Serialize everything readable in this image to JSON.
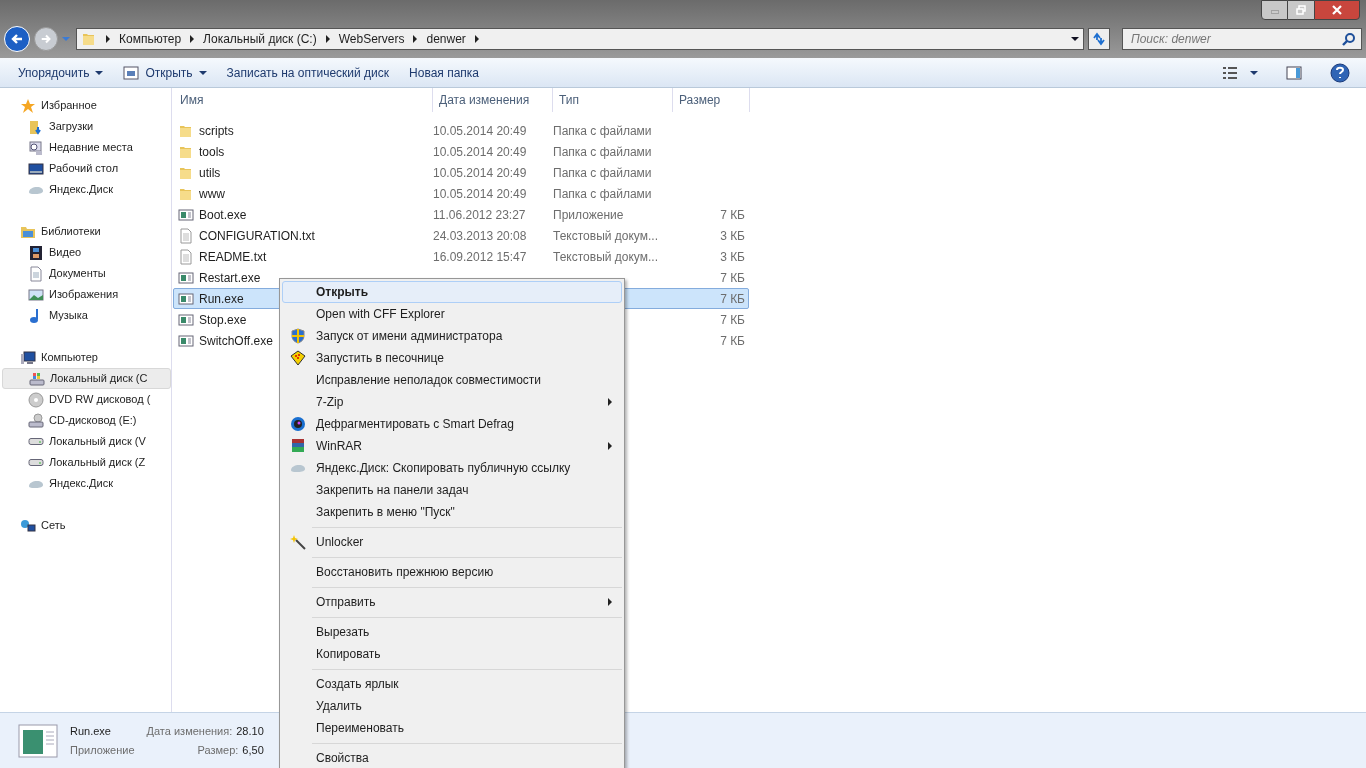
{
  "address": {
    "crumbs": [
      "Компьютер",
      "Локальный диск (C:)",
      "WebServers",
      "denwer"
    ]
  },
  "search": {
    "placeholder": "Поиск: denwer"
  },
  "toolbar": [
    {
      "label": "Упорядочить",
      "dropdown": true,
      "kind": "plain"
    },
    {
      "label": "Открыть",
      "dropdown": true,
      "kind": "open"
    },
    {
      "label": "Записать на оптический диск",
      "dropdown": false,
      "kind": "plain"
    },
    {
      "label": "Новая папка",
      "dropdown": false,
      "kind": "plain"
    }
  ],
  "sidebar": [
    {
      "label": "Избранное",
      "kind": "star",
      "children": [
        {
          "label": "Загрузки",
          "kind": "downloads",
          "selected": false
        },
        {
          "label": "Недавние места",
          "kind": "recent",
          "selected": false
        },
        {
          "label": "Рабочий стол",
          "kind": "desktop",
          "selected": false
        },
        {
          "label": "Яндекс.Диск",
          "kind": "cloud",
          "selected": false
        }
      ]
    },
    {
      "label": "Библиотеки",
      "kind": "library",
      "children": [
        {
          "label": "Видео",
          "kind": "video",
          "selected": false
        },
        {
          "label": "Документы",
          "kind": "docs",
          "selected": false
        },
        {
          "label": "Изображения",
          "kind": "images",
          "selected": false
        },
        {
          "label": "Музыка",
          "kind": "music",
          "selected": false
        }
      ]
    },
    {
      "label": "Компьютер",
      "kind": "computer",
      "children": [
        {
          "label": "Локальный диск (C",
          "kind": "sysdrive",
          "selected": true
        },
        {
          "label": "DVD RW дисковод (",
          "kind": "dvd",
          "selected": false
        },
        {
          "label": "CD-дисковод (E:)",
          "kind": "cd",
          "selected": false
        },
        {
          "label": "Локальный диск (V",
          "kind": "drive",
          "selected": false
        },
        {
          "label": "Локальный диск (Z",
          "kind": "drive",
          "selected": false
        },
        {
          "label": "Яндекс.Диск",
          "kind": "cloud",
          "selected": false
        }
      ]
    },
    {
      "label": "Сеть",
      "kind": "network"
    }
  ],
  "table": {
    "columns": [
      "Имя",
      "Дата изменения",
      "Тип",
      "Размер"
    ],
    "rows": [
      {
        "name": "scripts",
        "kind": "folder",
        "date": "10.05.2014 20:49",
        "type": "Папка с файлами",
        "selected": false
      },
      {
        "name": "tools",
        "kind": "folder",
        "date": "10.05.2014 20:49",
        "type": "Папка с файлами",
        "selected": false
      },
      {
        "name": "utils",
        "kind": "folder",
        "date": "10.05.2014 20:49",
        "type": "Папка с файлами",
        "selected": false
      },
      {
        "name": "www",
        "kind": "folder",
        "date": "10.05.2014 20:49",
        "type": "Папка с файлами",
        "selected": false
      },
      {
        "name": "Boot.exe",
        "kind": "exe",
        "date": "11.06.2012 23:27",
        "type": "Приложение",
        "size": "7 КБ",
        "selected": false
      },
      {
        "name": "CONFIGURATION.txt",
        "kind": "txt",
        "date": "24.03.2013 20:08",
        "type": "Текстовый докум...",
        "size": "3 КБ",
        "selected": false
      },
      {
        "name": "README.txt",
        "kind": "txt",
        "date": "16.09.2012 15:47",
        "type": "Текстовый докум...",
        "size": "3 КБ",
        "selected": false
      },
      {
        "name": "Restart.exe",
        "kind": "exe",
        "size": "7 КБ",
        "selected": false
      },
      {
        "name": "Run.exe",
        "kind": "exe",
        "size": "7 КБ",
        "selected": true
      },
      {
        "name": "Stop.exe",
        "kind": "exe",
        "size": "7 КБ",
        "selected": false
      },
      {
        "name": "SwitchOff.exe",
        "kind": "exe",
        "size": "7 КБ",
        "selected": false
      }
    ]
  },
  "context_menu": [
    [
      {
        "label": "Открыть",
        "kind": "plain",
        "bold": true,
        "submenu": false,
        "selected": true
      },
      {
        "label": "Open with CFF Explorer",
        "kind": "plain",
        "bold": false,
        "submenu": false,
        "selected": false
      },
      {
        "label": "Запуск от имени администратора",
        "kind": "shield",
        "bold": false,
        "submenu": false,
        "selected": false
      },
      {
        "label": "Запустить в песочнице",
        "kind": "sandbox",
        "bold": false,
        "submenu": false,
        "selected": false
      },
      {
        "label": "Исправление неполадок совместимости",
        "kind": "plain",
        "bold": false,
        "submenu": false,
        "selected": false
      },
      {
        "label": "7-Zip",
        "kind": "plain",
        "bold": false,
        "submenu": true,
        "selected": false
      },
      {
        "label": "Дефрагментировать с Smart Defrag",
        "kind": "defrag",
        "bold": false,
        "submenu": false,
        "selected": false
      },
      {
        "label": "WinRAR",
        "kind": "archive",
        "bold": false,
        "submenu": true,
        "selected": false
      },
      {
        "label": "Яндекс.Диск: Скопировать публичную ссылку",
        "kind": "cloud",
        "bold": false,
        "submenu": false,
        "selected": false
      },
      {
        "label": "Закрепить на панели задач",
        "kind": "plain",
        "bold": false,
        "submenu": false,
        "selected": false
      },
      {
        "label": "Закрепить в меню \"Пуск\"",
        "kind": "plain",
        "bold": false,
        "submenu": false,
        "selected": false
      }
    ],
    [
      {
        "label": "Unlocker",
        "kind": "wand",
        "bold": false,
        "submenu": false,
        "selected": false
      }
    ],
    [
      {
        "label": "Восстановить прежнюю версию",
        "kind": "plain",
        "bold": false,
        "submenu": false,
        "selected": false
      }
    ],
    [
      {
        "label": "Отправить",
        "kind": "plain",
        "bold": false,
        "submenu": true,
        "selected": false
      }
    ],
    [
      {
        "label": "Вырезать",
        "kind": "plain",
        "bold": false,
        "submenu": false,
        "selected": false
      },
      {
        "label": "Копировать",
        "kind": "plain",
        "bold": false,
        "submenu": false,
        "selected": false
      }
    ],
    [
      {
        "label": "Создать ярлык",
        "kind": "plain",
        "bold": false,
        "submenu": false,
        "selected": false
      },
      {
        "label": "Удалить",
        "kind": "plain",
        "bold": false,
        "submenu": false,
        "selected": false
      },
      {
        "label": "Переименовать",
        "kind": "plain",
        "bold": false,
        "submenu": false,
        "selected": false
      }
    ],
    [
      {
        "label": "Свойства",
        "kind": "plain",
        "bold": false,
        "submenu": false,
        "selected": false
      }
    ]
  ],
  "details": {
    "name": "Run.exe",
    "type": "Приложение",
    "fields": [
      {
        "label": "Дата изменения:",
        "value": "28.10"
      },
      {
        "label": "Размер:",
        "value": "6,50"
      }
    ]
  }
}
